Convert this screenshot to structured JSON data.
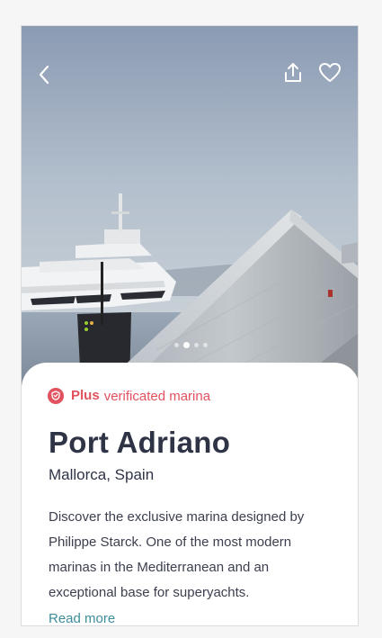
{
  "hero": {
    "image_description_icon": "marina-photo",
    "carousel": {
      "count": 4,
      "active_index": 1
    }
  },
  "top_bar": {
    "back_icon": "chevron-left-icon",
    "share_icon": "share-icon",
    "favorite_icon": "heart-icon"
  },
  "badge": {
    "icon": "shield-icon",
    "plus_label": "Plus",
    "text": "verificated marina",
    "color": "#e2525e"
  },
  "marina": {
    "name": "Port Adriano",
    "location": "Mallorca, Spain",
    "description": "Discover the exclusive marina designed by Philippe Starck. One of the most modern marinas in the Mediterranean and an exceptional base for superyachts.",
    "read_more_label": "Read more"
  },
  "colors": {
    "title": "#2e3346",
    "accent_link": "#3d8d9a"
  }
}
